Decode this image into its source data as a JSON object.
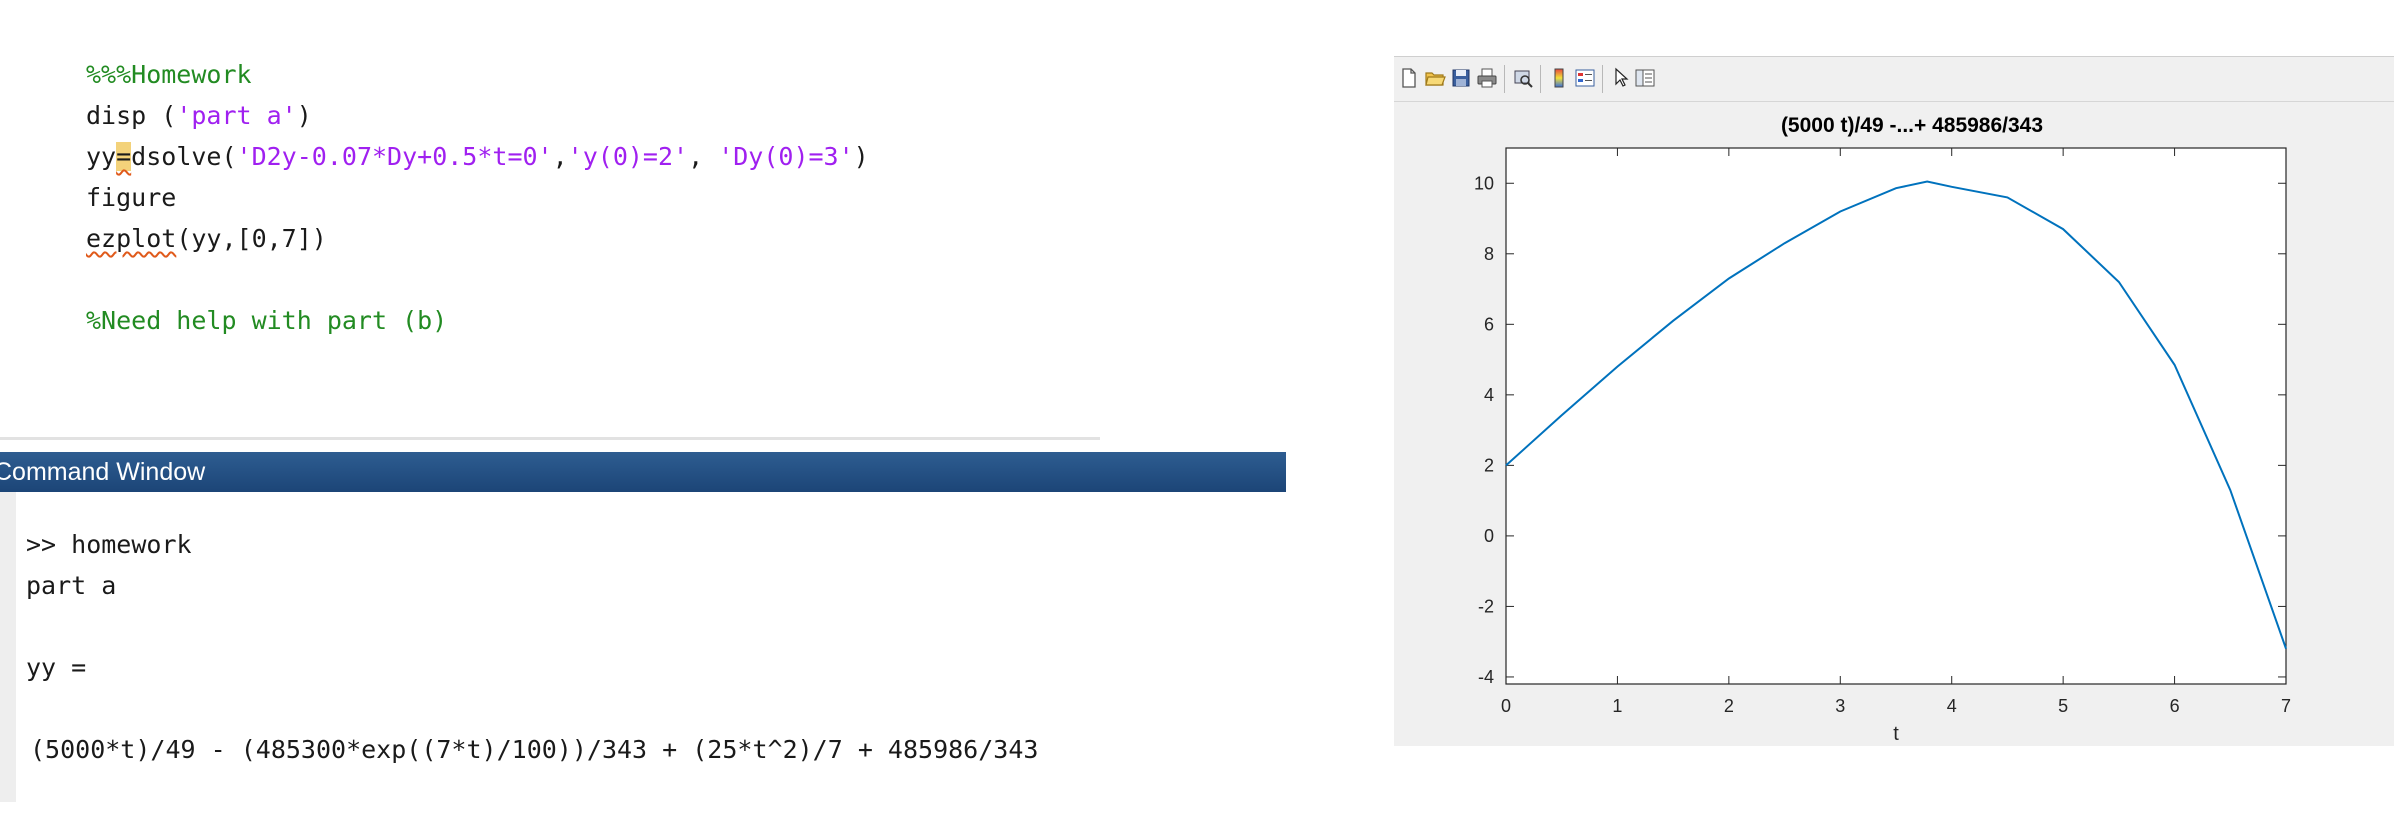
{
  "editor": {
    "line1": "%%%Homework",
    "line2_cmd": "disp (",
    "line2_str": "'part a'",
    "line2_end": ")",
    "line3_var": "yy",
    "line3_eq": "=",
    "line3_fn": "dsolve(",
    "line3_str1": "'D2y-0.07*Dy+0.5*t=0'",
    "line3_comma1": ",",
    "line3_str2": "'y(0)=2'",
    "line3_comma2": ", ",
    "line3_str3": "'Dy(0)=3'",
    "line3_end": ")",
    "line4": "figure",
    "line5_fn": "ezplot",
    "line5_args": "(yy,[0,7])",
    "line6": "%Need help with part (b)"
  },
  "command_window": {
    "title": "Command Window",
    "prompt_line": ">> homework",
    "output1": "part a",
    "output2": "yy =",
    "output3": "(5000*t)/49 - (485300*exp((7*t)/100))/343 + (25*t^2)/7 + 485986/343"
  },
  "figure": {
    "toolbar_icons": [
      "new-file-icon",
      "open-folder-icon",
      "save-icon",
      "print-icon",
      "print-preview-icon",
      "colorbar-icon",
      "legend-icon",
      "pointer-icon",
      "property-editor-icon"
    ]
  },
  "chart_data": {
    "type": "line",
    "title": "(5000 t)/49 -...+ 485986/343",
    "xlabel": "t",
    "ylabel": "",
    "xlim": [
      0,
      7
    ],
    "ylim": [
      -4.2,
      11
    ],
    "xticks": [
      "0",
      "1",
      "2",
      "3",
      "4",
      "5",
      "6",
      "7"
    ],
    "yticks": [
      "-4",
      "-2",
      "0",
      "2",
      "4",
      "6",
      "8",
      "10"
    ],
    "grid": false,
    "series": [
      {
        "x": [
          0,
          0.5,
          1,
          1.5,
          2,
          2.5,
          3,
          3.5,
          3.78,
          4,
          4.5,
          5,
          5.5,
          6,
          6.5,
          7
        ],
        "y": [
          2,
          3.42,
          4.8,
          6.1,
          7.3,
          8.3,
          9.2,
          9.86,
          10.05,
          9.9,
          9.6,
          8.7,
          7.2,
          4.85,
          1.3,
          -3.2
        ]
      }
    ],
    "line_color": "#0072bd"
  }
}
